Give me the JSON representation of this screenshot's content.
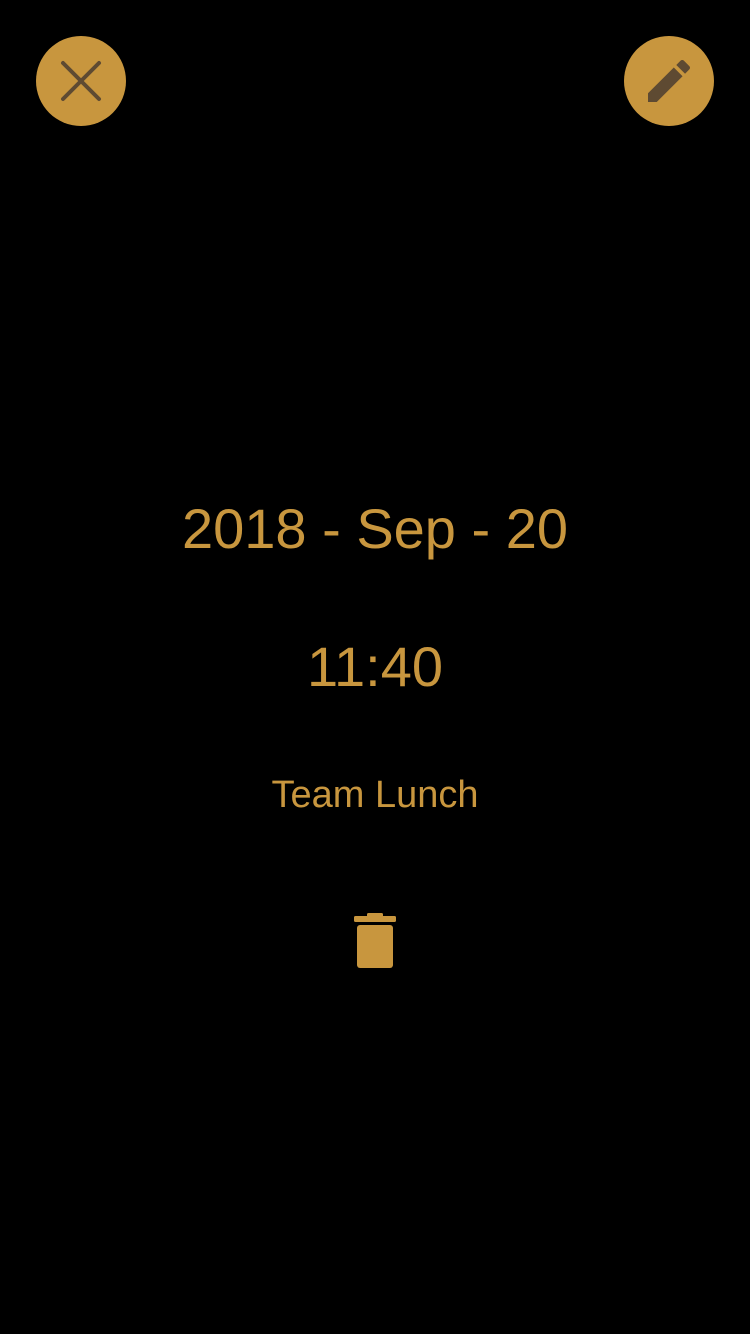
{
  "colors": {
    "background": "#000000",
    "accent": "#c8963e",
    "icon_glyph": "#5e4a32"
  },
  "toolbar": {
    "close_icon": "close-icon",
    "edit_icon": "pencil-icon"
  },
  "event": {
    "date": "2018 - Sep - 20",
    "time": "11:40",
    "title": "Team Lunch"
  },
  "actions": {
    "delete_icon": "trash-icon"
  }
}
